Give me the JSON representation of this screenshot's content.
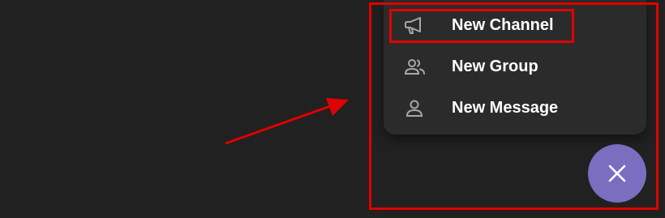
{
  "menu": {
    "items": [
      {
        "label": "New Channel",
        "icon": "megaphone-icon"
      },
      {
        "label": "New Group",
        "icon": "group-icon"
      },
      {
        "label": "New Message",
        "icon": "person-icon"
      }
    ]
  },
  "fab": {
    "icon": "close-icon"
  },
  "colors": {
    "background": "#212121",
    "menu_background": "#2b2b2b",
    "text": "#ffffff",
    "icon": "#a8a8a8",
    "fab": "#7b6dbf",
    "annotation": "#e10000"
  }
}
